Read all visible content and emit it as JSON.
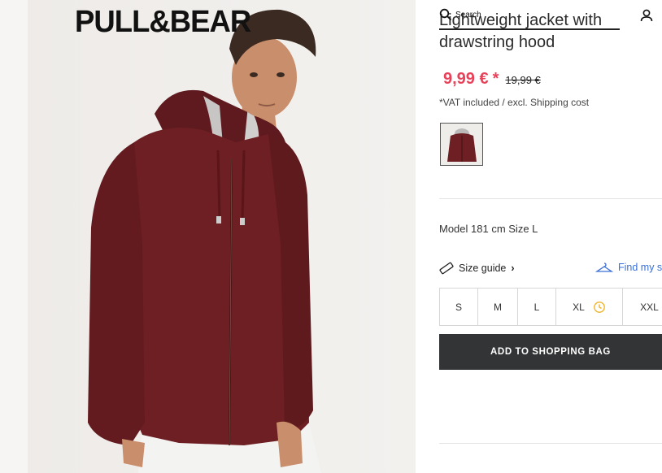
{
  "brand": {
    "logo_text": "PULL&BEAR"
  },
  "header": {
    "search_label": "Search",
    "search_icon": "search-icon",
    "account_icon": "user-icon"
  },
  "product": {
    "title": "Lightweight jacket with drawstring hood",
    "price_current": "9,99 €",
    "price_marker": "*",
    "price_old": "19,99 €",
    "vat_note": "*VAT included / excl. Shipping cost",
    "model_info": "Model 181 cm Size L",
    "colors": {
      "accent": "#e8425a",
      "jacket": "#6e1f23",
      "button_bg": "#333436",
      "link": "#3a6fd8"
    }
  },
  "size_section": {
    "size_guide_label": "Size guide",
    "find_size_label": "Find my s",
    "sizes": [
      {
        "label": "S",
        "low_stock": false
      },
      {
        "label": "M",
        "low_stock": false
      },
      {
        "label": "L",
        "low_stock": false
      },
      {
        "label": "XL",
        "low_stock": true
      },
      {
        "label": "XXL",
        "low_stock": false
      }
    ]
  },
  "actions": {
    "add_to_bag": "ADD TO SHOPPING BAG"
  }
}
